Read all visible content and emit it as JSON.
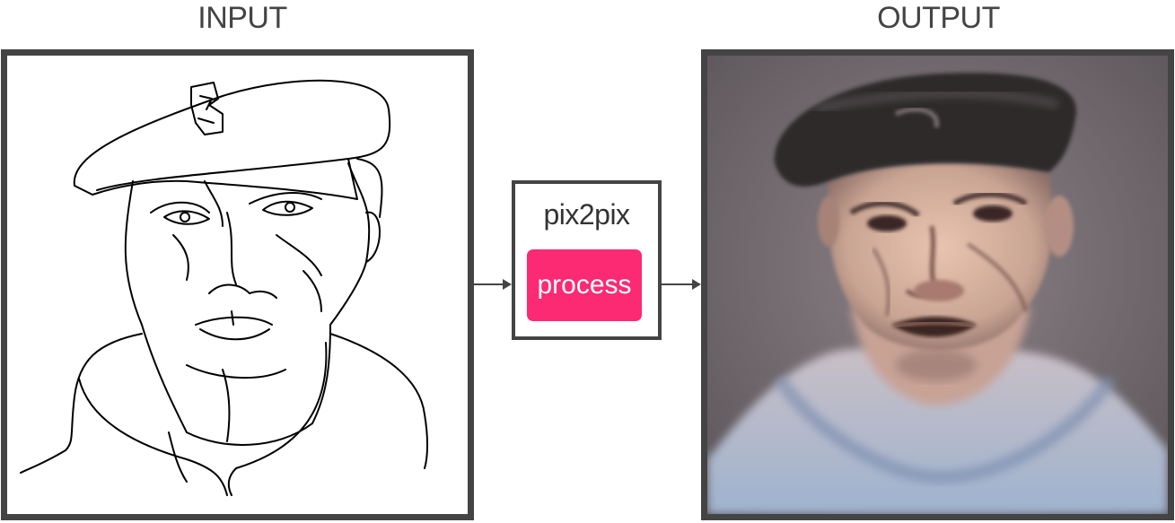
{
  "input": {
    "title": "INPUT"
  },
  "output": {
    "title": "OUTPUT"
  },
  "model": {
    "name": "pix2pix",
    "button_label": "process"
  },
  "colors": {
    "frame_border": "#444444",
    "button_bg": "#fc2a72",
    "sketch_stroke": "#000000",
    "output_background": "#6b6468"
  },
  "icons": {
    "arrow_left": "arrow-right-icon",
    "arrow_right": "arrow-right-icon"
  }
}
